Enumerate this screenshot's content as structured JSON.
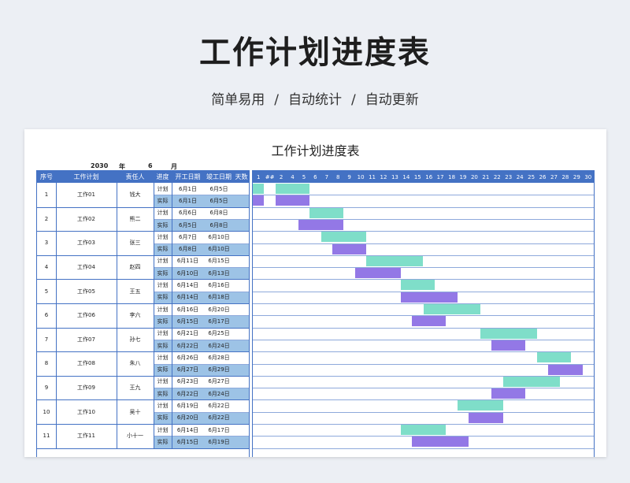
{
  "title": "工作计划进度表",
  "subtitle": [
    "简单易用",
    "自动统计",
    "自动更新"
  ],
  "sheet": {
    "title": "工作计划进度表",
    "year": "2030",
    "year_label": "年",
    "month": "6",
    "month_label": "月",
    "headers": [
      "序号",
      "工作计划",
      "责任人",
      "进度",
      "开工日期",
      "竣工日期",
      "天数"
    ],
    "plan_label": "计划",
    "actual_label": "实际",
    "day_headers": [
      "1",
      "##",
      "2",
      "4",
      "5",
      "6",
      "7",
      "8",
      "9",
      "10",
      "11",
      "12",
      "13",
      "14",
      "15",
      "16",
      "17",
      "18",
      "19",
      "20",
      "21",
      "22",
      "23",
      "24",
      "25",
      "26",
      "27",
      "28",
      "29",
      "30"
    ],
    "rows": [
      {
        "no": "1",
        "task": "工作01",
        "owner": "钱大",
        "plan_start": "6月1日",
        "plan_end": "6月5日",
        "act_start": "6月1日",
        "act_end": "6月5日",
        "plan_bars": [
          [
            1,
            1
          ],
          [
            3,
            5
          ]
        ],
        "act_bars": [
          [
            1,
            1
          ],
          [
            3,
            5
          ]
        ]
      },
      {
        "no": "2",
        "task": "工作02",
        "owner": "熊二",
        "plan_start": "6月6日",
        "plan_end": "6月8日",
        "act_start": "6月5日",
        "act_end": "6月8日",
        "plan_bars": [
          [
            6,
            8
          ]
        ],
        "act_bars": [
          [
            5,
            8
          ]
        ]
      },
      {
        "no": "3",
        "task": "工作03",
        "owner": "张三",
        "plan_start": "6月7日",
        "plan_end": "6月10日",
        "act_start": "6月8日",
        "act_end": "6月10日",
        "plan_bars": [
          [
            7,
            10
          ]
        ],
        "act_bars": [
          [
            8,
            10
          ]
        ]
      },
      {
        "no": "4",
        "task": "工作04",
        "owner": "赵四",
        "plan_start": "6月11日",
        "plan_end": "6月15日",
        "act_start": "6月10日",
        "act_end": "6月13日",
        "plan_bars": [
          [
            11,
            15
          ]
        ],
        "act_bars": [
          [
            10,
            13
          ]
        ]
      },
      {
        "no": "5",
        "task": "工作05",
        "owner": "王五",
        "plan_start": "6月14日",
        "plan_end": "6月16日",
        "act_start": "6月14日",
        "act_end": "6月18日",
        "plan_bars": [
          [
            14,
            16
          ]
        ],
        "act_bars": [
          [
            14,
            18
          ]
        ]
      },
      {
        "no": "6",
        "task": "工作06",
        "owner": "李六",
        "plan_start": "6月16日",
        "plan_end": "6月20日",
        "act_start": "6月15日",
        "act_end": "6月17日",
        "plan_bars": [
          [
            16,
            20
          ]
        ],
        "act_bars": [
          [
            15,
            17
          ]
        ]
      },
      {
        "no": "7",
        "task": "工作07",
        "owner": "孙七",
        "plan_start": "6月21日",
        "plan_end": "6月25日",
        "act_start": "6月22日",
        "act_end": "6月24日",
        "plan_bars": [
          [
            21,
            25
          ]
        ],
        "act_bars": [
          [
            22,
            24
          ]
        ]
      },
      {
        "no": "8",
        "task": "工作08",
        "owner": "朱八",
        "plan_start": "6月26日",
        "plan_end": "6月28日",
        "act_start": "6月27日",
        "act_end": "6月29日",
        "plan_bars": [
          [
            26,
            28
          ]
        ],
        "act_bars": [
          [
            27,
            29
          ]
        ]
      },
      {
        "no": "9",
        "task": "工作09",
        "owner": "王九",
        "plan_start": "6月23日",
        "plan_end": "6月27日",
        "act_start": "6月22日",
        "act_end": "6月24日",
        "plan_bars": [
          [
            23,
            27
          ]
        ],
        "act_bars": [
          [
            22,
            24
          ]
        ]
      },
      {
        "no": "10",
        "task": "工作10",
        "owner": "吴十",
        "plan_start": "6月19日",
        "plan_end": "6月22日",
        "act_start": "6月20日",
        "act_end": "6月22日",
        "plan_bars": [
          [
            19,
            22
          ]
        ],
        "act_bars": [
          [
            20,
            22
          ]
        ]
      },
      {
        "no": "11",
        "task": "工作11",
        "owner": "小十一",
        "plan_start": "6月14日",
        "plan_end": "6月17日",
        "act_start": "6月15日",
        "act_end": "6月19日",
        "plan_bars": [
          [
            14,
            17
          ]
        ],
        "act_bars": [
          [
            15,
            19
          ]
        ]
      }
    ],
    "colors": {
      "header": "#4472c4",
      "actual_row": "#9dc3e6",
      "plan_bar": "#7fdec9",
      "actual_bar": "#9378e6"
    }
  }
}
